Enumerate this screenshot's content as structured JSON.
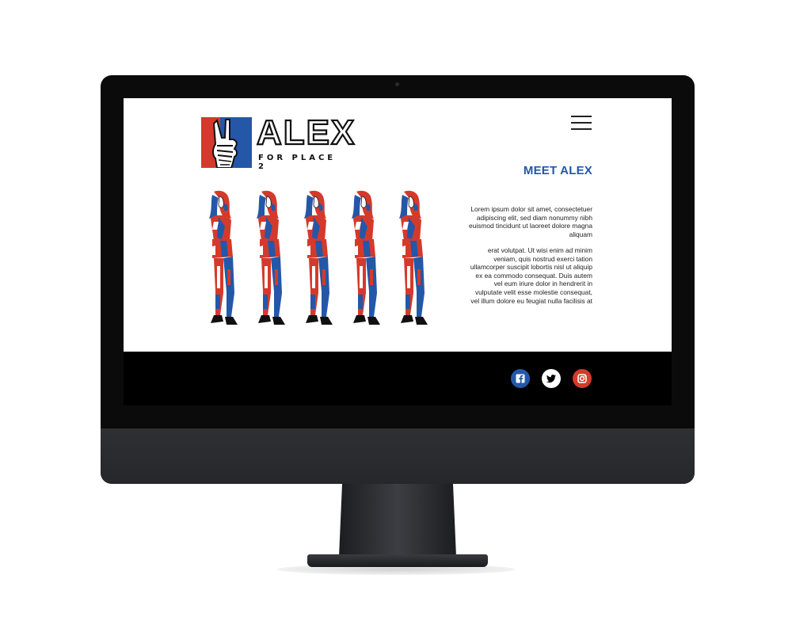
{
  "brand": {
    "title": "ALEX",
    "subtitle": "FOR PLACE 2",
    "colors": {
      "red": "#d43a2b",
      "blue": "#2457a8",
      "dark": "#111111"
    }
  },
  "nav": {
    "menu_icon": "hamburger-menu-icon"
  },
  "main": {
    "heading": "MEET ALEX",
    "paragraph1": "Lorem ipsum dolor sit amet, consectetuer adipiscing elit, sed diam nonummy nibh euismod tincidunt ut laoreet dolore magna aliquam",
    "paragraph2": "erat volutpat. Ut wisi enim ad minim veniam, quis nostrud exerci tation ullamcorper suscipit lobortis nisl ut aliquip ex ea commodo consequat. Duis autem vel eum iriure dolor in hendrerit in vulputate velit esse molestie consequat, vel illum dolore eu feugiat nulla facilisis at",
    "figure_count": 5
  },
  "footer": {
    "social": [
      {
        "icon": "facebook-icon",
        "color": "#2457a8"
      },
      {
        "icon": "twitter-icon",
        "color": "#ffffff"
      },
      {
        "icon": "instagram-icon",
        "color": "#d43a2b"
      }
    ]
  }
}
